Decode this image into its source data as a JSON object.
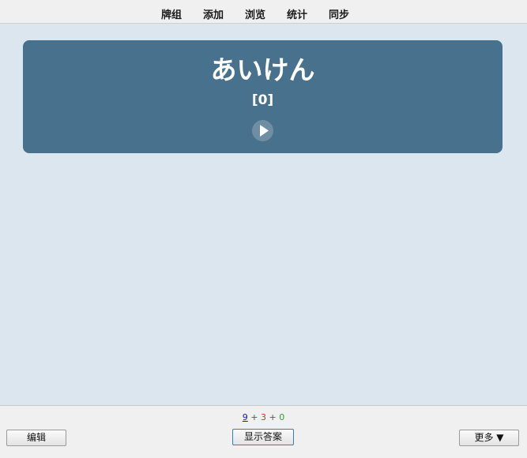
{
  "toolbar": {
    "items": [
      {
        "label": "牌组"
      },
      {
        "label": "添加"
      },
      {
        "label": "浏览"
      },
      {
        "label": "统计"
      },
      {
        "label": "同步"
      }
    ]
  },
  "card": {
    "word": "あいけん",
    "reading": "[0]",
    "play_icon": "play-icon"
  },
  "counts": {
    "new": "9",
    "learning": "3",
    "review": "0",
    "separator": "+"
  },
  "buttons": {
    "edit": "编辑",
    "show_answer": "显示答案",
    "more": "更多 ▼"
  },
  "colors": {
    "card_background": "#48718e",
    "main_background": "#dce6ee",
    "new_count": "#1a1aa6",
    "learning_count": "#c0392b",
    "review_count": "#2e9e3a"
  }
}
